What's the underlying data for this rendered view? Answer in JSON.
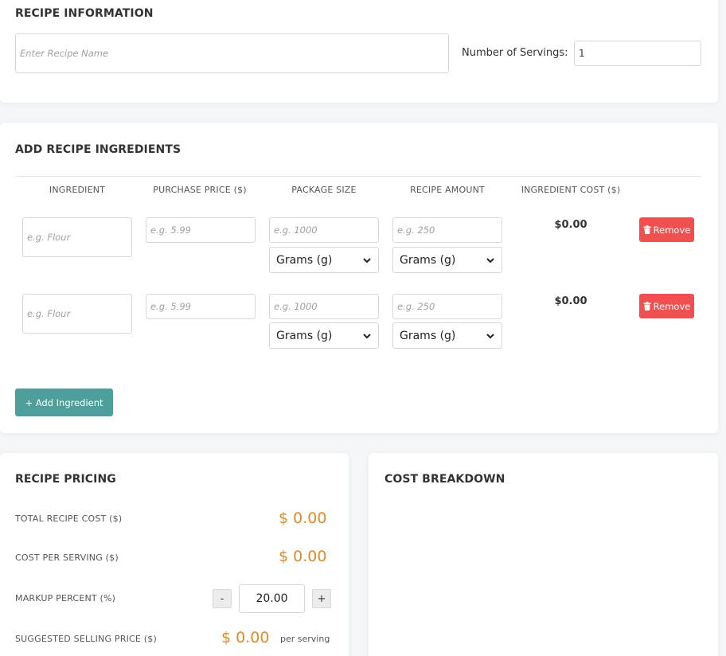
{
  "recipe_info": {
    "title": "RECIPE INFORMATION",
    "name_placeholder": "Enter Recipe Name",
    "servings_label": "Number of Servings:",
    "servings_value": "1"
  },
  "ingredients": {
    "title": "ADD RECIPE INGREDIENTS",
    "columns": [
      "INGREDIENT",
      "PURCHASE PRICE ($)",
      "PACKAGE SIZE",
      "RECIPE AMOUNT",
      "INGREDIENT COST ($)"
    ],
    "rows": [
      {
        "name_placeholder": "e.g. Flour",
        "price_placeholder": "e.g. 5.99",
        "package_placeholder": "e.g. 1000",
        "package_unit": "Grams (g)",
        "amount_placeholder": "e.g. 250",
        "amount_unit": "Grams (g)",
        "cost": "$0.00",
        "remove_label": "Remove"
      },
      {
        "name_placeholder": "e.g. Flour",
        "price_placeholder": "e.g. 5.99",
        "package_placeholder": "e.g. 1000",
        "package_unit": "Grams (g)",
        "amount_placeholder": "e.g. 250",
        "amount_unit": "Grams (g)",
        "cost": "$0.00",
        "remove_label": "Remove"
      }
    ],
    "add_label": "+ Add Ingredient"
  },
  "pricing": {
    "title": "RECIPE PRICING",
    "total_label": "TOTAL RECIPE COST ($)",
    "total_value": "$ 0.00",
    "per_serving_label": "COST PER SERVING ($)",
    "per_serving_value": "$ 0.00",
    "markup_label": "MARKUP PERCENT (%)",
    "markup_value": "20.00",
    "minus_label": "-",
    "plus_label": "+",
    "suggested_label": "SUGGESTED SELLING PRICE ($)",
    "suggested_value": "$ 0.00",
    "per_serving_suffix": "per serving"
  },
  "breakdown": {
    "title": "COST BREAKDOWN"
  },
  "colors": {
    "accent": "#4e9e9b",
    "danger": "#f0504f",
    "price": "#e08a2c"
  }
}
